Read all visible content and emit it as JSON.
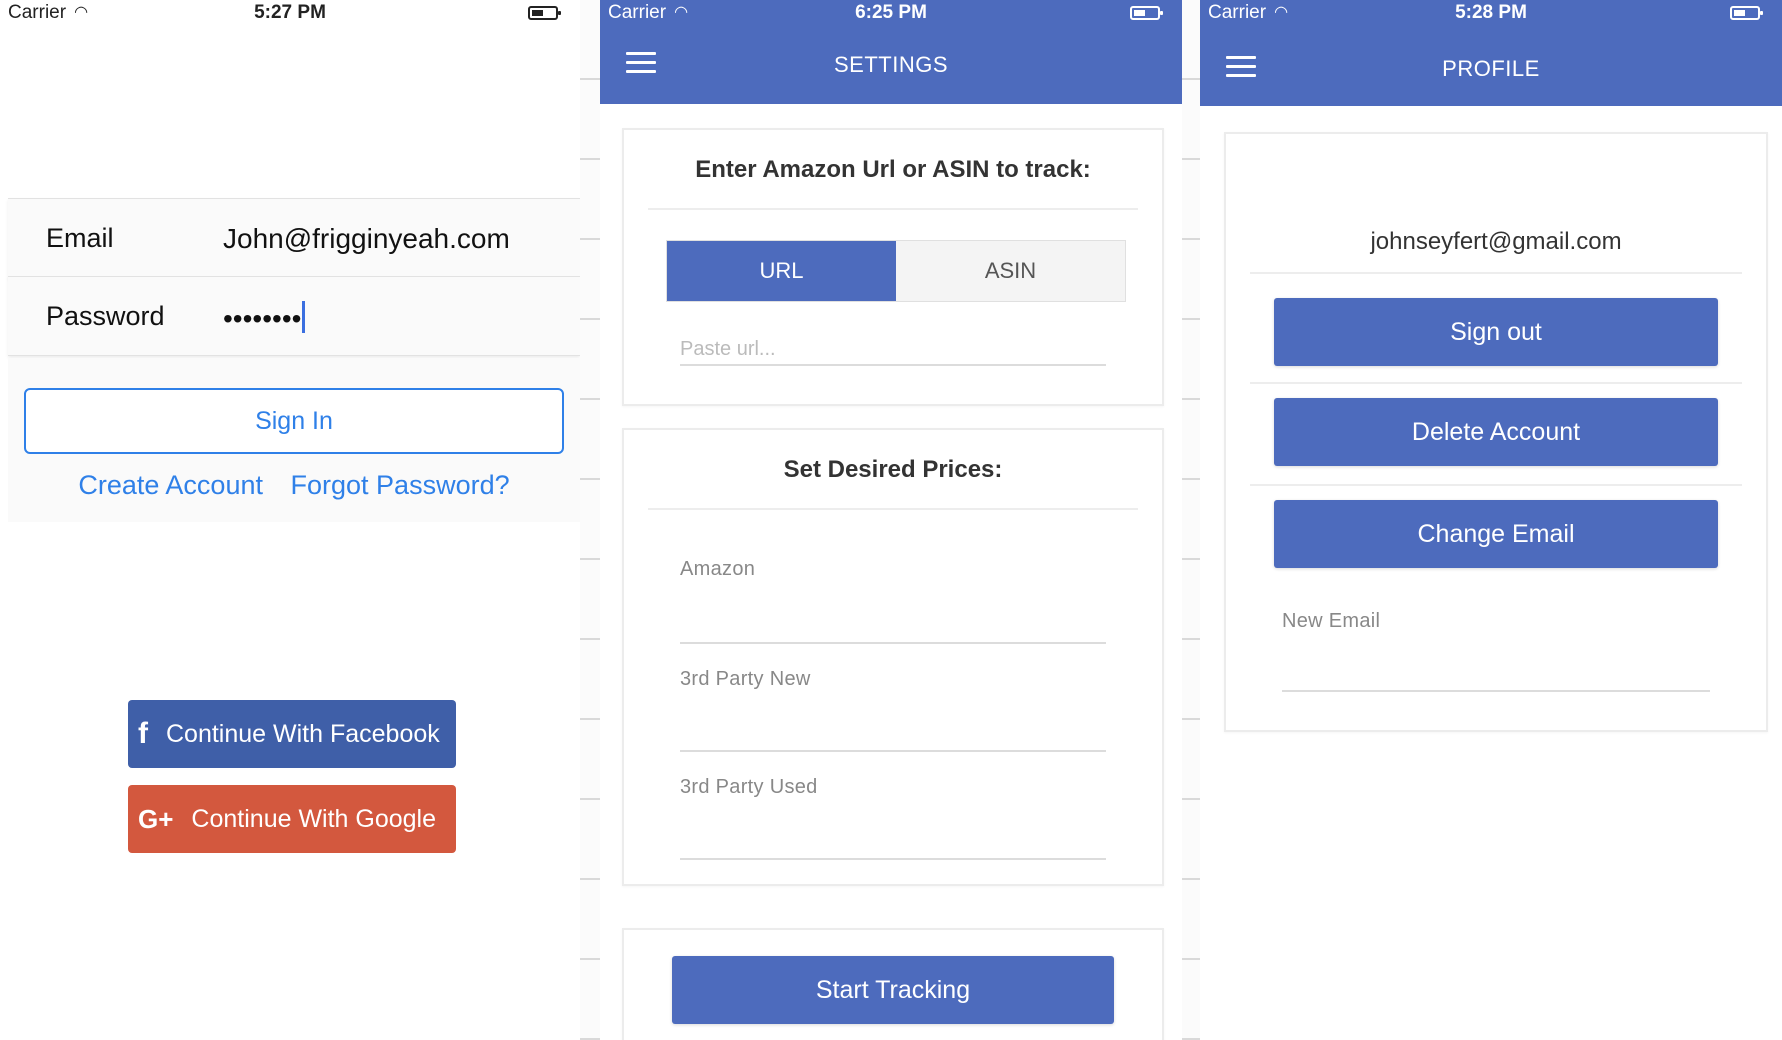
{
  "login": {
    "status": {
      "carrier": "Carrier",
      "time": "5:27 PM"
    },
    "email_label": "Email",
    "email_value": "John@frigginyeah.com",
    "password_label": "Password",
    "password_value": "••••••••",
    "sign_in": "Sign In",
    "create_account": "Create Account",
    "forgot_password": "Forgot Password?",
    "facebook_icon": "f",
    "facebook": "Continue With Facebook",
    "google_icon": "G+",
    "google": "Continue With Google"
  },
  "settings": {
    "status": {
      "carrier": "Carrier",
      "time": "6:25 PM"
    },
    "title": "SETTINGS",
    "track_heading": "Enter Amazon Url or ASIN to track:",
    "segments": [
      "URL",
      "ASIN"
    ],
    "selected_segment": "URL",
    "url_placeholder": "Paste url...",
    "prices_heading": "Set Desired Prices:",
    "price_fields": [
      "Amazon",
      "3rd Party New",
      "3rd Party Used"
    ],
    "start_tracking": "Start Tracking"
  },
  "profile": {
    "status": {
      "carrier": "Carrier",
      "time": "5:28 PM"
    },
    "title": "PROFILE",
    "email": "johnseyfert@gmail.com",
    "sign_out": "Sign out",
    "delete_account": "Delete Account",
    "change_email": "Change Email",
    "new_email_label": "New Email"
  },
  "colors": {
    "nav_blue": "#4d6bbd",
    "link_blue": "#2f80e8",
    "facebook": "#3f5fa8",
    "google": "#d3583e"
  }
}
